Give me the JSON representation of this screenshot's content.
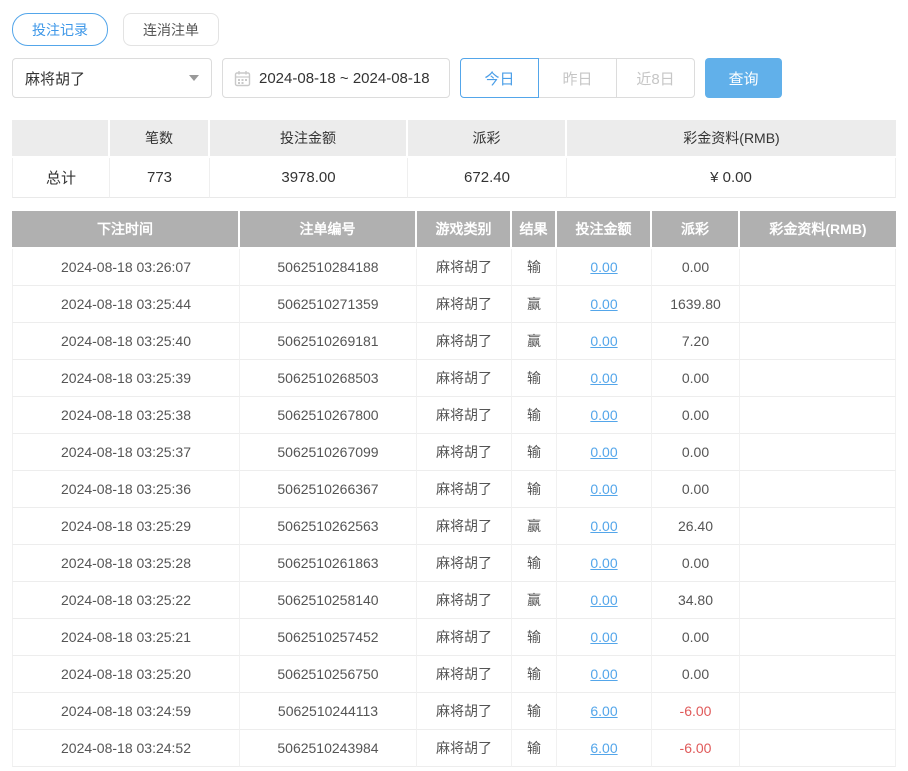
{
  "tabs": [
    {
      "label": "投注记录",
      "active": true
    },
    {
      "label": "连消注单",
      "active": false
    }
  ],
  "filters": {
    "game_select_value": "麻将胡了",
    "date_range_value": "2024-08-18 ~ 2024-08-18",
    "quick_ranges": [
      "今日",
      "昨日",
      "近8日"
    ],
    "active_quick_range": "今日",
    "query_button_label": "查询"
  },
  "summary": {
    "headers": [
      "",
      "笔数",
      "投注金额",
      "派彩",
      "彩金资料(RMB)"
    ],
    "total_label": "总计",
    "count": "773",
    "bet_amount": "3978.00",
    "payout": "672.40",
    "bonus": "¥ 0.00"
  },
  "table": {
    "headers": [
      "下注时间",
      "注单编号",
      "游戏类别",
      "结果",
      "投注金额",
      "派彩",
      "彩金资料(RMB)"
    ],
    "rows": [
      {
        "time": "2024-08-18 03:26:07",
        "order": "5062510284188",
        "game": "麻将胡了",
        "result": "输",
        "bet": "0.00",
        "payout": "0.00",
        "bonus": ""
      },
      {
        "time": "2024-08-18 03:25:44",
        "order": "5062510271359",
        "game": "麻将胡了",
        "result": "赢",
        "bet": "0.00",
        "payout": "1639.80",
        "bonus": ""
      },
      {
        "time": "2024-08-18 03:25:40",
        "order": "5062510269181",
        "game": "麻将胡了",
        "result": "赢",
        "bet": "0.00",
        "payout": "7.20",
        "bonus": ""
      },
      {
        "time": "2024-08-18 03:25:39",
        "order": "5062510268503",
        "game": "麻将胡了",
        "result": "输",
        "bet": "0.00",
        "payout": "0.00",
        "bonus": ""
      },
      {
        "time": "2024-08-18 03:25:38",
        "order": "5062510267800",
        "game": "麻将胡了",
        "result": "输",
        "bet": "0.00",
        "payout": "0.00",
        "bonus": ""
      },
      {
        "time": "2024-08-18 03:25:37",
        "order": "5062510267099",
        "game": "麻将胡了",
        "result": "输",
        "bet": "0.00",
        "payout": "0.00",
        "bonus": ""
      },
      {
        "time": "2024-08-18 03:25:36",
        "order": "5062510266367",
        "game": "麻将胡了",
        "result": "输",
        "bet": "0.00",
        "payout": "0.00",
        "bonus": ""
      },
      {
        "time": "2024-08-18 03:25:29",
        "order": "5062510262563",
        "game": "麻将胡了",
        "result": "赢",
        "bet": "0.00",
        "payout": "26.40",
        "bonus": ""
      },
      {
        "time": "2024-08-18 03:25:28",
        "order": "5062510261863",
        "game": "麻将胡了",
        "result": "输",
        "bet": "0.00",
        "payout": "0.00",
        "bonus": ""
      },
      {
        "time": "2024-08-18 03:25:22",
        "order": "5062510258140",
        "game": "麻将胡了",
        "result": "赢",
        "bet": "0.00",
        "payout": "34.80",
        "bonus": ""
      },
      {
        "time": "2024-08-18 03:25:21",
        "order": "5062510257452",
        "game": "麻将胡了",
        "result": "输",
        "bet": "0.00",
        "payout": "0.00",
        "bonus": ""
      },
      {
        "time": "2024-08-18 03:25:20",
        "order": "5062510256750",
        "game": "麻将胡了",
        "result": "输",
        "bet": "0.00",
        "payout": "0.00",
        "bonus": ""
      },
      {
        "time": "2024-08-18 03:24:59",
        "order": "5062510244113",
        "game": "麻将胡了",
        "result": "输",
        "bet": "6.00",
        "payout": "-6.00",
        "bonus": ""
      },
      {
        "time": "2024-08-18 03:24:52",
        "order": "5062510243984",
        "game": "麻将胡了",
        "result": "输",
        "bet": "6.00",
        "payout": "-6.00",
        "bonus": ""
      }
    ]
  },
  "colors": {
    "accent_blue": "#54a6ea",
    "query_button_bg": "#61b0ea",
    "table_header_bg": "#b0b0b0",
    "summary_header_bg": "#ececec",
    "negative_red": "#e05a5a",
    "link_blue": "#54a6ea"
  }
}
